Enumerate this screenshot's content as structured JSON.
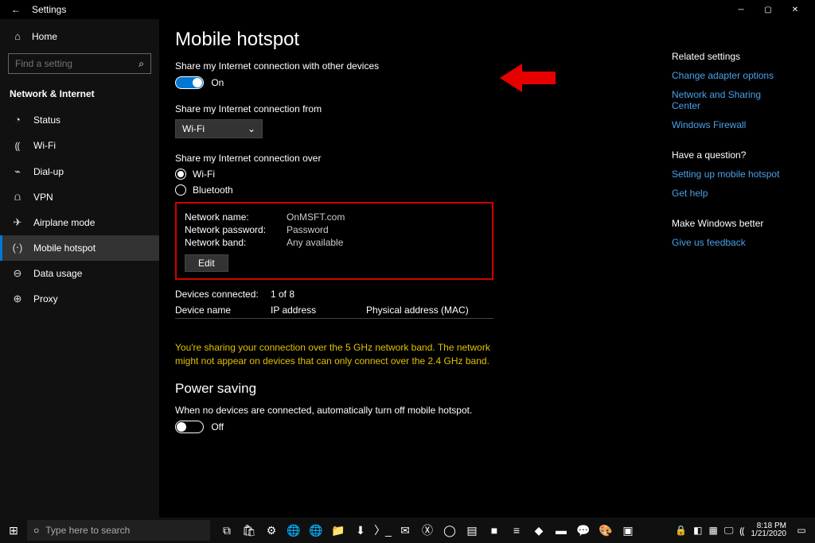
{
  "window": {
    "title": "Settings"
  },
  "sidebar": {
    "home": "Home",
    "search_placeholder": "Find a setting",
    "section": "Network & Internet",
    "items": [
      {
        "icon": "◔",
        "label": "Status"
      },
      {
        "icon": "�ريد",
        "label": "Wi-Fi"
      },
      {
        "icon": "⌁",
        "label": "Dial-up"
      },
      {
        "icon": "⋔",
        "label": "VPN"
      },
      {
        "icon": "✈",
        "label": "Airplane mode"
      },
      {
        "icon": "((•))",
        "label": "Mobile hotspot"
      },
      {
        "icon": "⊖",
        "label": "Data usage"
      },
      {
        "icon": "⊕",
        "label": "Proxy"
      }
    ]
  },
  "main": {
    "title": "Mobile hotspot",
    "share_text": "Share my Internet connection with other devices",
    "share_state": "On",
    "from_label": "Share my Internet connection from",
    "from_value": "Wi-Fi",
    "over_label": "Share my Internet connection over",
    "over_wifi": "Wi-Fi",
    "over_bt": "Bluetooth",
    "net_name_k": "Network name:",
    "net_name_v": "OnMSFT.com",
    "net_pass_k": "Network password:",
    "net_pass_v": "Password",
    "net_band_k": "Network band:",
    "net_band_v": "Any available",
    "edit": "Edit",
    "devices_k": "Devices connected:",
    "devices_v": "1 of 8",
    "col_device": "Device name",
    "col_ip": "IP address",
    "col_mac": "Physical address (MAC)",
    "warn": "You're sharing your connection over the 5 GHz network band. The network might not appear on devices that can only connect over the 2.4 GHz band.",
    "ps_title": "Power saving",
    "ps_text": "When no devices are connected, automatically turn off mobile hotspot.",
    "ps_state": "Off"
  },
  "right": {
    "related_title": "Related settings",
    "related_links": [
      "Change adapter options",
      "Network and Sharing Center",
      "Windows Firewall"
    ],
    "question_title": "Have a question?",
    "question_links": [
      "Setting up mobile hotspot",
      "Get help"
    ],
    "better_title": "Make Windows better",
    "better_links": [
      "Give us feedback"
    ]
  },
  "taskbar": {
    "search": "Type here to search",
    "time": "8:18 PM",
    "date": "1/21/2020"
  }
}
